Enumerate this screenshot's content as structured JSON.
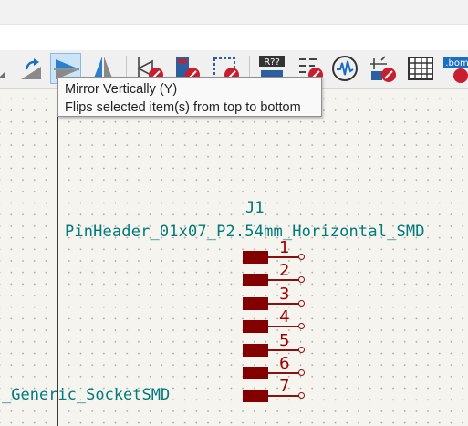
{
  "toolbar": {
    "buttons": [
      {
        "name": "rotate-cw-button",
        "icon": "rotate-clockwise-icon"
      },
      {
        "name": "mirror-vertically-button",
        "icon": "mirror-vertical-icon",
        "active": true
      },
      {
        "name": "mirror-horizontally-button",
        "icon": "mirror-horizontal-icon"
      },
      {
        "name": "edit-symbol-fields-button",
        "icon": "edit-fields-icon"
      },
      {
        "name": "symbol-editor-button",
        "icon": "symbol-editor-icon"
      },
      {
        "name": "edit-library-symbol-button",
        "icon": "edit-library-icon"
      },
      {
        "name": "annotate-button",
        "icon": "annotate-icon",
        "label": "R??"
      },
      {
        "name": "erc-button",
        "icon": "erc-icon"
      },
      {
        "name": "simulator-button",
        "icon": "simulator-icon"
      },
      {
        "name": "assign-footprints-button",
        "icon": "footprint-assign-icon"
      },
      {
        "name": "bom-table-button",
        "icon": "table-icon"
      },
      {
        "name": "bom-export-button",
        "icon": "bom-icon",
        "label": ".bom"
      }
    ]
  },
  "tooltip": {
    "title": "Mirror Vertically  (Y)",
    "description": "Flips selected item(s) from top to bottom"
  },
  "schematic": {
    "reference": "J1",
    "value": "PinHeader_01x07_P2.54mm_Horizontal_SMD",
    "other_value": "_Generic_SocketSMD",
    "pins": [
      "1",
      "2",
      "3",
      "4",
      "5",
      "6",
      "7"
    ]
  },
  "colors": {
    "field_text": "#007a7a",
    "pin": "#840000",
    "pin_number": "#a00000",
    "canvas": "#f5f4ef",
    "active_button": "#cce4f7"
  }
}
